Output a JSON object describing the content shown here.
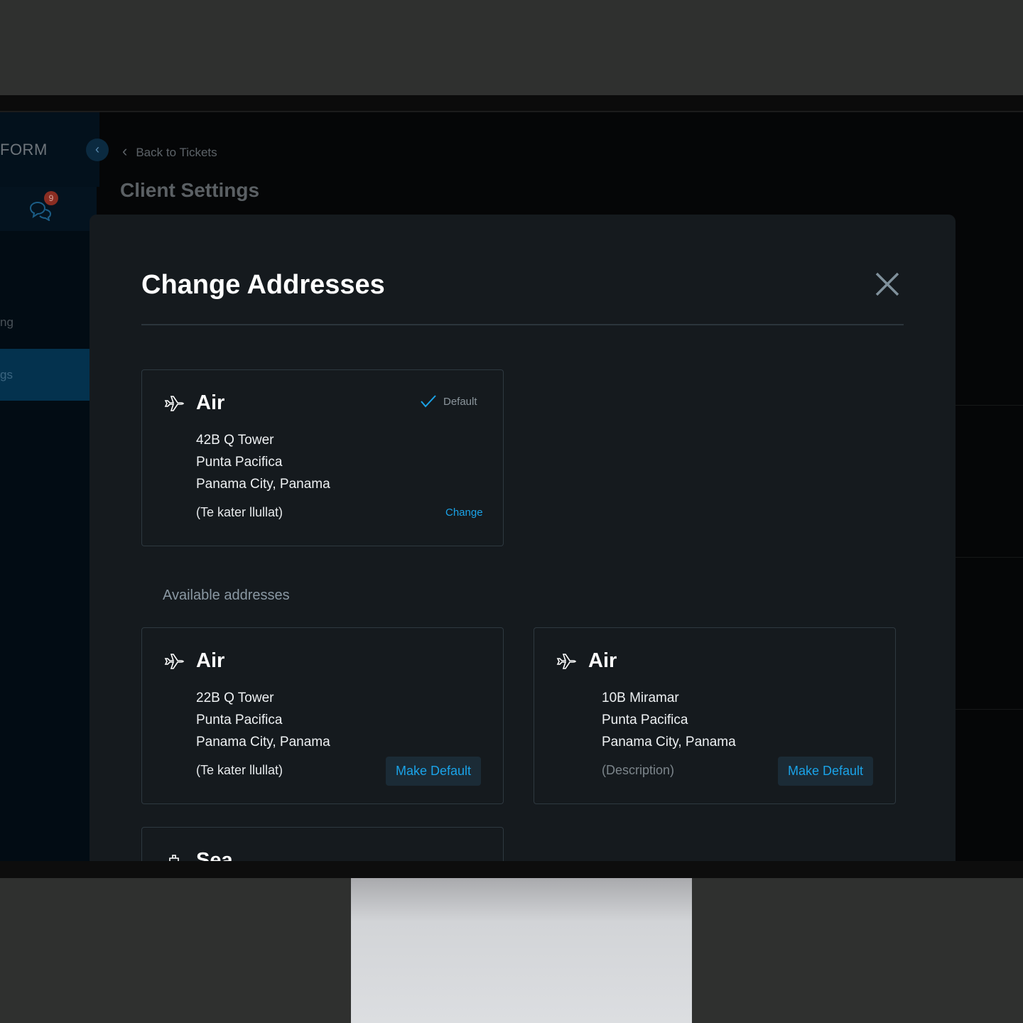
{
  "sidebar": {
    "brand": "FORM",
    "badge_count": "9",
    "nav_item_partial": "ng",
    "nav_active_partial": "gs"
  },
  "header": {
    "back_label": "Back to Tickets",
    "page_title": "Client Settings"
  },
  "modal": {
    "title": "Change Addresses",
    "default_card": {
      "type": "Air",
      "lines": [
        "42B Q Tower",
        "Punta Pacifica",
        "Panama City, Panama"
      ],
      "description": "(Te kater llullat)",
      "default_label": "Default",
      "change_label": "Change"
    },
    "available_heading": "Available addresses",
    "available": [
      {
        "type": "Air",
        "lines": [
          "22B Q Tower",
          "Punta Pacifica",
          "Panama City, Panama"
        ],
        "description": "(Te kater llullat)",
        "button": "Make Default"
      },
      {
        "type": "Air",
        "lines": [
          "10B Miramar",
          "Punta Pacifica",
          "Panama City, Panama"
        ],
        "description": "(Description)",
        "button": "Make Default"
      },
      {
        "type": "Sea"
      }
    ]
  },
  "colors": {
    "accent": "#1aa3e8",
    "modal_bg": "#151a1e",
    "badge": "#8a2d22"
  }
}
